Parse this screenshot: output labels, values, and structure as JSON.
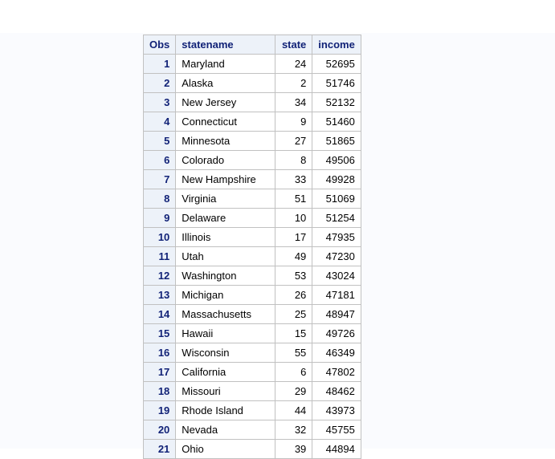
{
  "table": {
    "columns": [
      "Obs",
      "statename",
      "state",
      "income"
    ],
    "rows": [
      {
        "obs": "1",
        "statename": "Maryland",
        "state": "24",
        "income": "52695"
      },
      {
        "obs": "2",
        "statename": "Alaska",
        "state": "2",
        "income": "51746"
      },
      {
        "obs": "3",
        "statename": "New Jersey",
        "state": "34",
        "income": "52132"
      },
      {
        "obs": "4",
        "statename": "Connecticut",
        "state": "9",
        "income": "51460"
      },
      {
        "obs": "5",
        "statename": "Minnesota",
        "state": "27",
        "income": "51865"
      },
      {
        "obs": "6",
        "statename": "Colorado",
        "state": "8",
        "income": "49506"
      },
      {
        "obs": "7",
        "statename": "New Hampshire",
        "state": "33",
        "income": "49928"
      },
      {
        "obs": "8",
        "statename": "Virginia",
        "state": "51",
        "income": "51069"
      },
      {
        "obs": "9",
        "statename": "Delaware",
        "state": "10",
        "income": "51254"
      },
      {
        "obs": "10",
        "statename": "Illinois",
        "state": "17",
        "income": "47935"
      },
      {
        "obs": "11",
        "statename": "Utah",
        "state": "49",
        "income": "47230"
      },
      {
        "obs": "12",
        "statename": "Washington",
        "state": "53",
        "income": "43024"
      },
      {
        "obs": "13",
        "statename": "Michigan",
        "state": "26",
        "income": "47181"
      },
      {
        "obs": "14",
        "statename": "Massachusetts",
        "state": "25",
        "income": "48947"
      },
      {
        "obs": "15",
        "statename": "Hawaii",
        "state": "15",
        "income": "49726"
      },
      {
        "obs": "16",
        "statename": "Wisconsin",
        "state": "55",
        "income": "46349"
      },
      {
        "obs": "17",
        "statename": "California",
        "state": "6",
        "income": "47802"
      },
      {
        "obs": "18",
        "statename": "Missouri",
        "state": "29",
        "income": "48462"
      },
      {
        "obs": "19",
        "statename": "Rhode Island",
        "state": "44",
        "income": "43973"
      },
      {
        "obs": "20",
        "statename": "Nevada",
        "state": "32",
        "income": "45755"
      },
      {
        "obs": "21",
        "statename": "Ohio",
        "state": "39",
        "income": "44894"
      }
    ]
  },
  "colors": {
    "header_bg": "#edf2f9",
    "header_text": "#112277",
    "border": "#c1c1c1",
    "page_bg": "#fafbfe"
  }
}
